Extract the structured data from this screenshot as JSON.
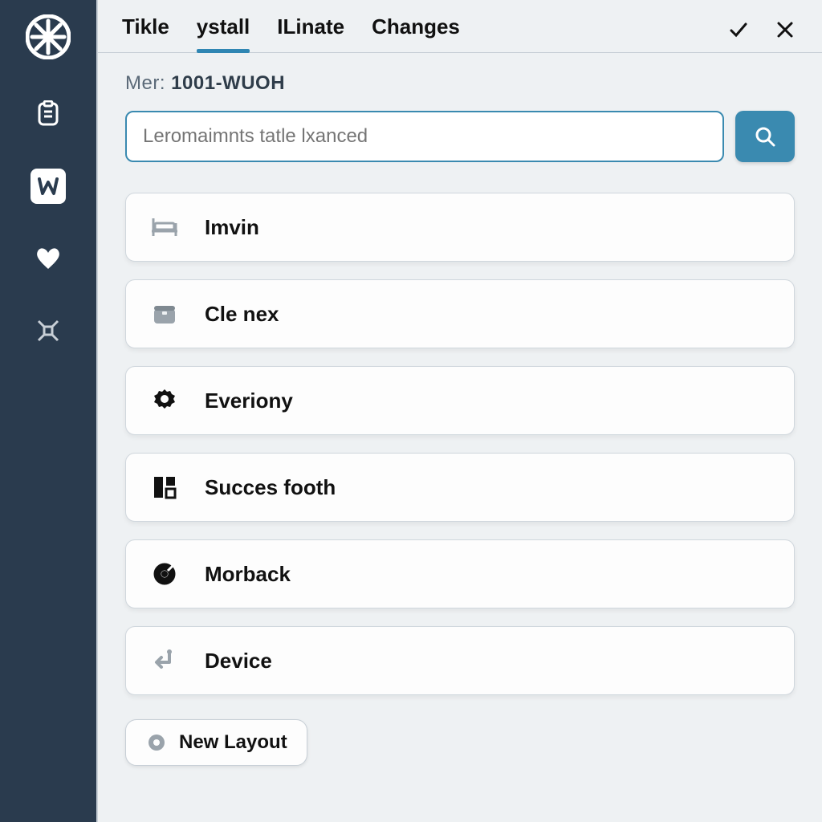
{
  "tabs": {
    "items": [
      {
        "label": "Tikle",
        "active": false
      },
      {
        "label": "ystall",
        "active": true
      },
      {
        "label": "ILinate",
        "active": false
      },
      {
        "label": "Changes",
        "active": false
      }
    ]
  },
  "meta": {
    "prefix": "Mer:",
    "value": "1001-WUOH"
  },
  "search": {
    "placeholder": "Leromaimnts tatle lxanced"
  },
  "list": {
    "items": [
      {
        "icon": "bed-icon",
        "label": "Imvin"
      },
      {
        "icon": "box-icon",
        "label": "Cle nex"
      },
      {
        "icon": "gear-icon",
        "label": "Everiony"
      },
      {
        "icon": "columns-icon",
        "label": "Succes footh"
      },
      {
        "icon": "target-icon",
        "label": "Morback"
      },
      {
        "icon": "route-icon",
        "label": "Device"
      }
    ]
  },
  "footer": {
    "new_layout_label": "New Layout"
  }
}
